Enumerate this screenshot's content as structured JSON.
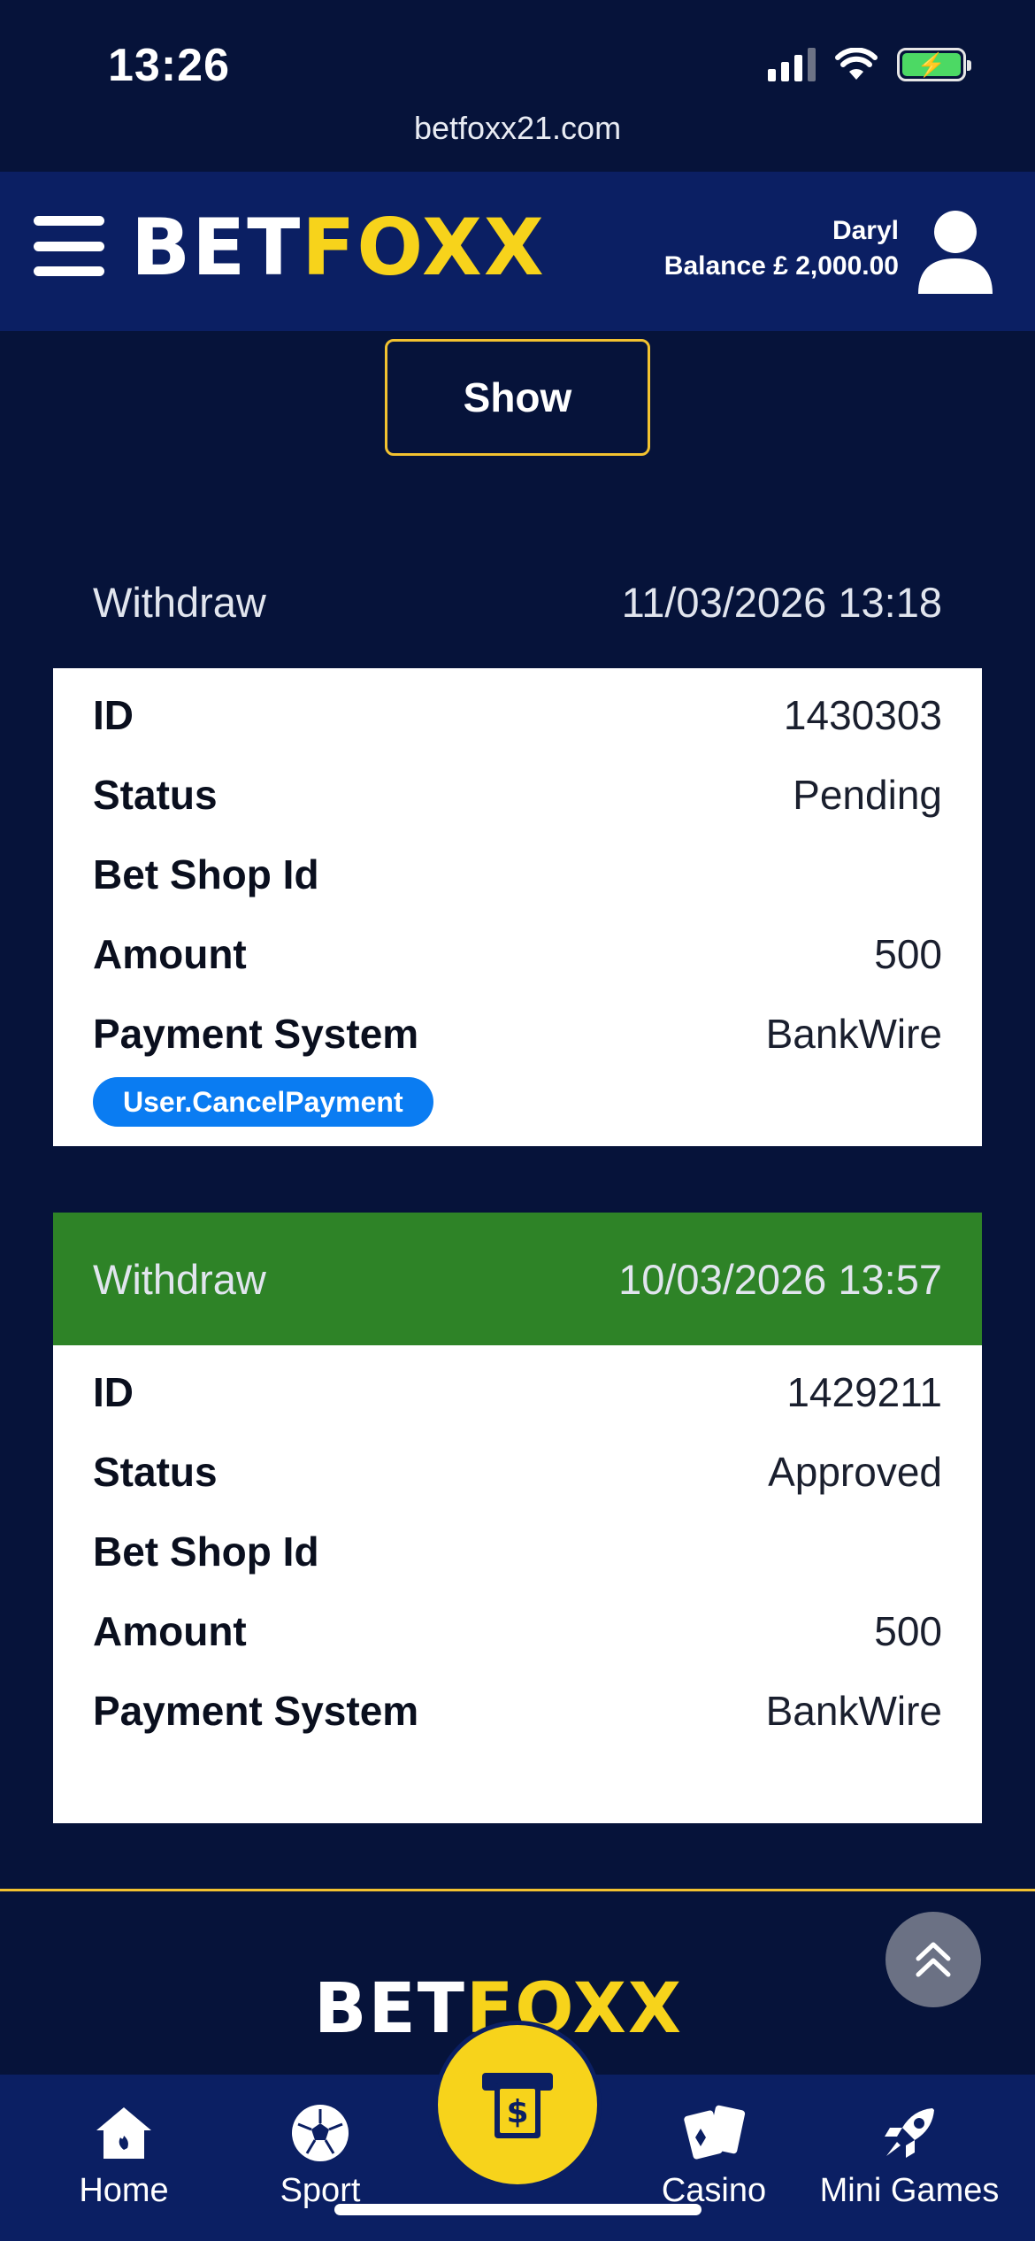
{
  "status_bar": {
    "time": "13:26",
    "url": "betfoxx21.com",
    "battery_icon": "battery-charging-icon"
  },
  "header": {
    "logo_white": "BET",
    "logo_yellow": "FOXX",
    "user_name": "Daryl",
    "balance": "Balance £ 2,000.00"
  },
  "show_button": "Show",
  "transactions": [
    {
      "type": "Withdraw",
      "datetime": "11/03/2026 13:18",
      "fields": [
        {
          "label": "ID",
          "value": "1430303"
        },
        {
          "label": "Status",
          "value": "Pending"
        },
        {
          "label": "Bet Shop Id",
          "value": ""
        },
        {
          "label": "Amount",
          "value": "500"
        },
        {
          "label": "Payment System",
          "value": "BankWire"
        }
      ],
      "action": "User.CancelPayment"
    },
    {
      "type": "Withdraw",
      "datetime": "10/03/2026 13:57",
      "header_color": "#2e8327",
      "fields": [
        {
          "label": "ID",
          "value": "1429211"
        },
        {
          "label": "Status",
          "value": "Approved"
        },
        {
          "label": "Bet Shop Id",
          "value": ""
        },
        {
          "label": "Amount",
          "value": "500"
        },
        {
          "label": "Payment System",
          "value": "BankWire"
        }
      ]
    }
  ],
  "footer": {
    "logo_white": "BET",
    "logo_yellow": "FOXX"
  },
  "bottom_nav": {
    "home": "Home",
    "sport": "Sport",
    "casino": "Casino",
    "mini_games": "Mini Games"
  },
  "colors": {
    "background": "#06133a",
    "header": "#0b1f63",
    "accent": "#f7d31b",
    "approved": "#2e8327",
    "pill": "#0a7cf2"
  }
}
